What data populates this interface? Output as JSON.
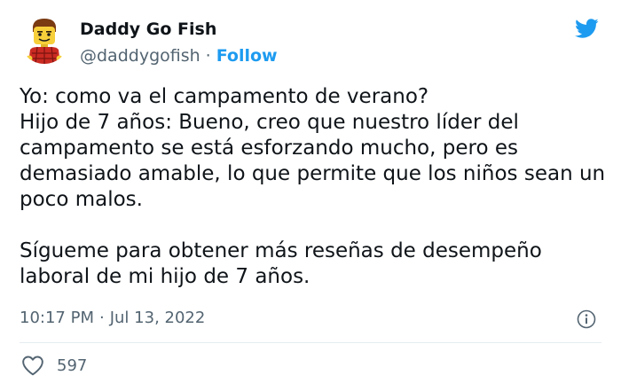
{
  "tweet": {
    "author": {
      "display_name": "Daddy Go Fish",
      "handle": "@daddygofish",
      "separator": "·",
      "follow_label": "Follow"
    },
    "brand_logo": "twitter-bird-icon",
    "text": "Yo: como va el campamento de verano?\nHijo de 7 años: Bueno, creo que nuestro líder del campamento se está esforzando mucho, pero es demasiado amable, lo que permite que los niños sean un poco malos.\n\nSígueme para obtener más reseñas de desempeño laboral de mi hijo de 7 años.",
    "time": "10:17 PM",
    "meta_separator": "·",
    "date": "Jul 13, 2022",
    "likes": "597"
  },
  "colors": {
    "accent": "#1d9bf0",
    "text": "#0f1419",
    "muted": "#536471",
    "divider": "#e6ecf0"
  }
}
